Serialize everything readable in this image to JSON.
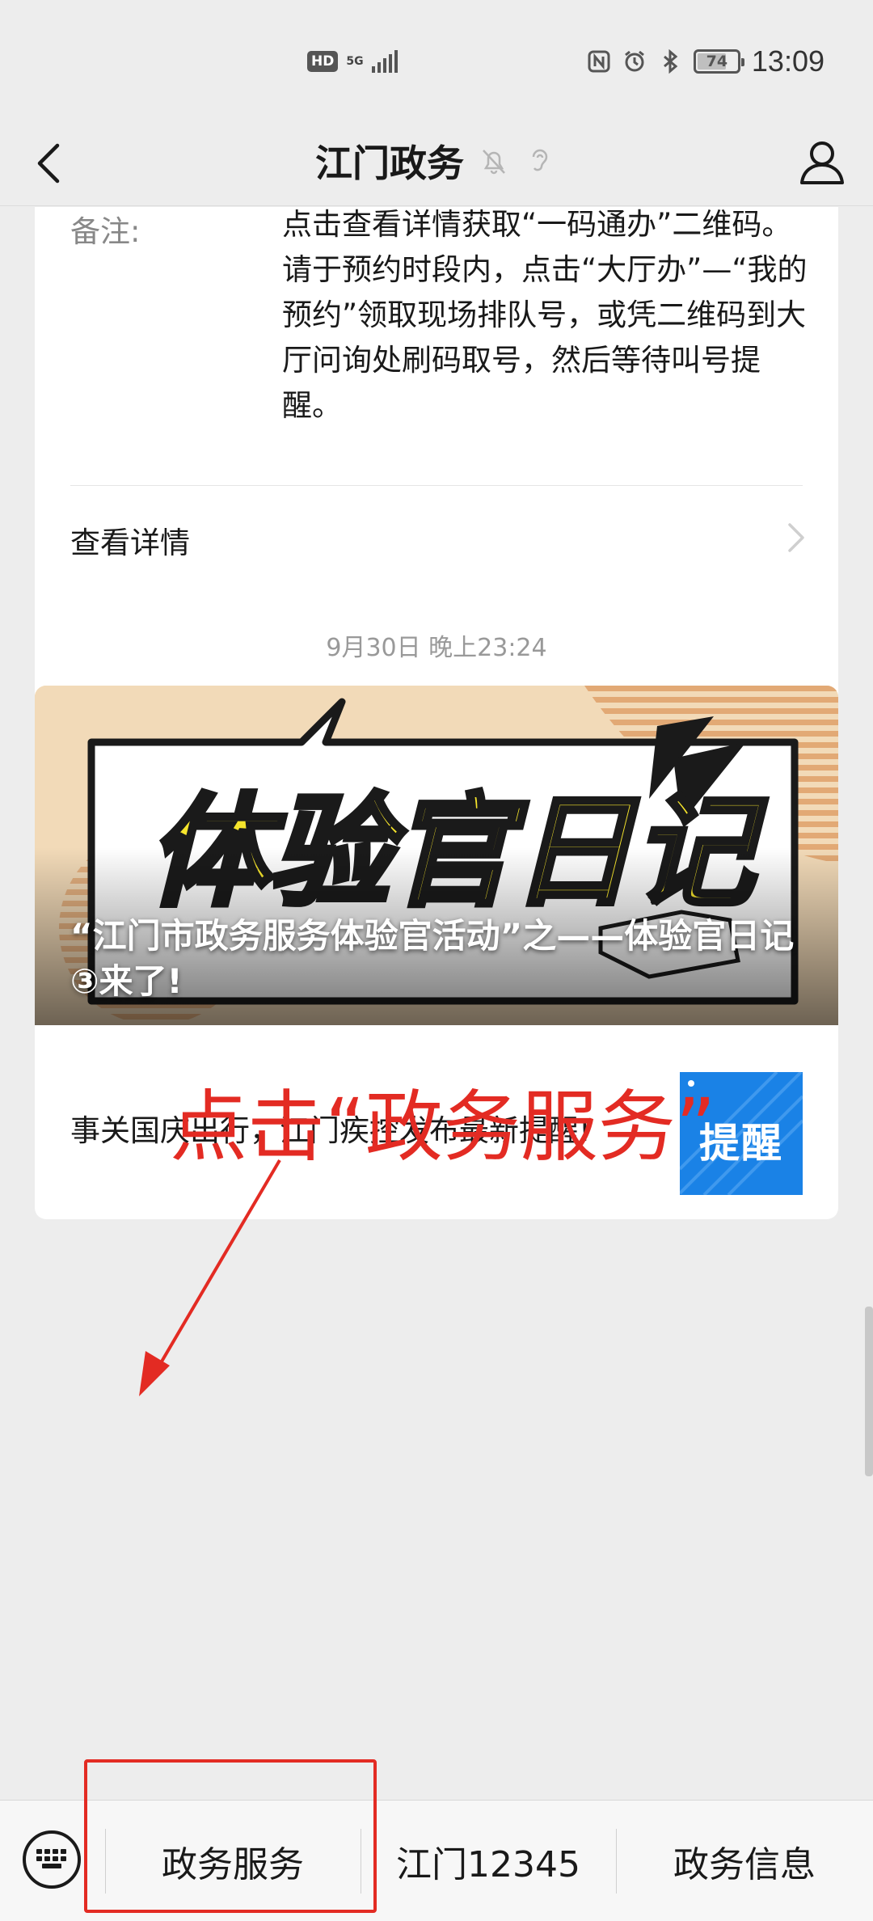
{
  "status_bar": {
    "hd": "HD",
    "network": "5G",
    "battery": "74",
    "battery_level": 0.74,
    "time": "13:09"
  },
  "navbar": {
    "title": "江门政务",
    "icons": [
      "back-chevron-icon",
      "mute-bell-icon",
      "ear-icon",
      "profile-icon"
    ]
  },
  "message_card": {
    "note_label": "备注:",
    "note_text": "点击查看详情获取“一码通办”二维码。请于预约时段内，点击“大厅办”—“我的预约”领取现场排队号，或凭二维码到大厅问询处刷码取号，然后等待叫号提醒。",
    "details_label": "查看详情"
  },
  "timestamp": "9月30日 晚上23:24",
  "article": {
    "cover_art_text": "体验官日记",
    "cover_title": "“江门市政务服务体验官活动”之——体验官日记③来了!",
    "sub_title": "事关国庆出行，江门疾控发布最新提醒!",
    "sub_thumb_text": "提醒",
    "colors": {
      "cover_bg": "#f1d6b2",
      "art_yellow": "#f6e52c",
      "thumb_blue": "#1a82e6"
    }
  },
  "annotation": {
    "text": "点击“政务服务”",
    "color": "#e32b23"
  },
  "bottom_menu": {
    "items": [
      "政务服务",
      "江门12345",
      "政务信息"
    ],
    "keyboard_icon": "keyboard-icon"
  }
}
